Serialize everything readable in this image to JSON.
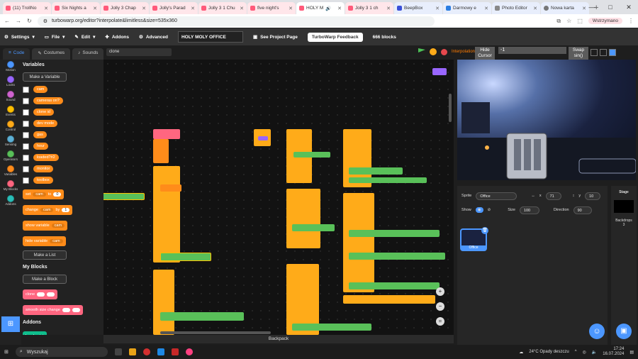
{
  "browser": {
    "tabs": [
      {
        "label": "(11) TrollNo"
      },
      {
        "label": "Six Nights a"
      },
      {
        "label": "Jolly 3 Chap"
      },
      {
        "label": "Jolly's Parad"
      },
      {
        "label": "Jolly 3 1 Chu"
      },
      {
        "label": "five night's"
      },
      {
        "label": "HOLY M"
      },
      {
        "label": "Jolly 3 1 ch"
      },
      {
        "label": "BeepBox"
      },
      {
        "label": "Darmowy e"
      },
      {
        "label": "Photo Editor"
      },
      {
        "label": "Nowa karta"
      }
    ],
    "new_tab": "+",
    "url": "turbowarp.org/editor?interpolate&limitless&size=535x360",
    "profile": "Wstrzymano",
    "win_min": "—",
    "win_max": "□",
    "win_close": "✕"
  },
  "menubar": {
    "settings": "Settings",
    "file": "File",
    "edit": "Edit",
    "addons": "Addons",
    "advanced": "Advanced",
    "project_title": "HOLY MOLY OFFICE",
    "see_project": "See Project Page",
    "feedback": "TurboWarp Feedback",
    "block_count": "666 blocks"
  },
  "editor_tabs": {
    "code": "Code",
    "costumes": "Costumes",
    "sounds": "Sounds"
  },
  "categories": [
    {
      "label": "Motion",
      "color": "#4c97ff"
    },
    {
      "label": "Looks",
      "color": "#9966ff"
    },
    {
      "label": "Sound",
      "color": "#cf63cf"
    },
    {
      "label": "Events",
      "color": "#ffbf00"
    },
    {
      "label": "Control",
      "color": "#ffab19"
    },
    {
      "label": "Sensing",
      "color": "#5cb1d6"
    },
    {
      "label": "Operators",
      "color": "#59c059"
    },
    {
      "label": "Variables",
      "color": "#ff8c1a"
    },
    {
      "label": "My Blocks",
      "color": "#ff6680"
    },
    {
      "label": "Addons",
      "color": "#29beb8"
    }
  ],
  "palette": {
    "variables_heading": "Variables",
    "make_variable": "Make a Variable",
    "variables": [
      "cam",
      "cameras on?",
      "clone id",
      "dev mode",
      "gas",
      "hour",
      "loaded?#2",
      "monitor",
      "toolbox"
    ],
    "set_block": {
      "verb": "set",
      "var": "cam",
      "to": "to",
      "value": "0"
    },
    "change_block": {
      "verb": "change",
      "var": "cam",
      "by": "by",
      "value": "1"
    },
    "show_block": {
      "verb": "show variable",
      "var": "cam"
    },
    "hide_block": {
      "verb": "hide variable",
      "var": "cam"
    },
    "make_list": "Make a List",
    "myblocks_heading": "My Blocks",
    "make_block": "Make a Block",
    "clone_block": "clone",
    "smooth_block": "smooth size change",
    "addons_heading": "Addons",
    "breakpoint": "breakpoint"
  },
  "search": {
    "value": "clone"
  },
  "stage_controls": {
    "interpolation": "Interpolation",
    "hide_cursor": "Hide Cursor",
    "number": "-1",
    "swap": "Swap sin()"
  },
  "sprite_info": {
    "sprite_label": "Sprite",
    "sprite_name": "Office",
    "x_label": "x",
    "x": "71",
    "y_label": "y",
    "y": "10",
    "show_label": "Show",
    "size_label": "Size",
    "size": "100",
    "direction_label": "Direction",
    "direction": "90",
    "thumb_label": "Office"
  },
  "stage_panel": {
    "title": "Stage",
    "backdrops_label": "Backdrops",
    "backdrops": "3"
  },
  "backpack": "Backpack",
  "zoom": {
    "in": "+",
    "out": "−",
    "reset": "="
  },
  "taskbar": {
    "search": "Wyszukaj",
    "weather": "24°C  Opady deszczu",
    "time": "17:24",
    "date": "16.07.2024"
  }
}
